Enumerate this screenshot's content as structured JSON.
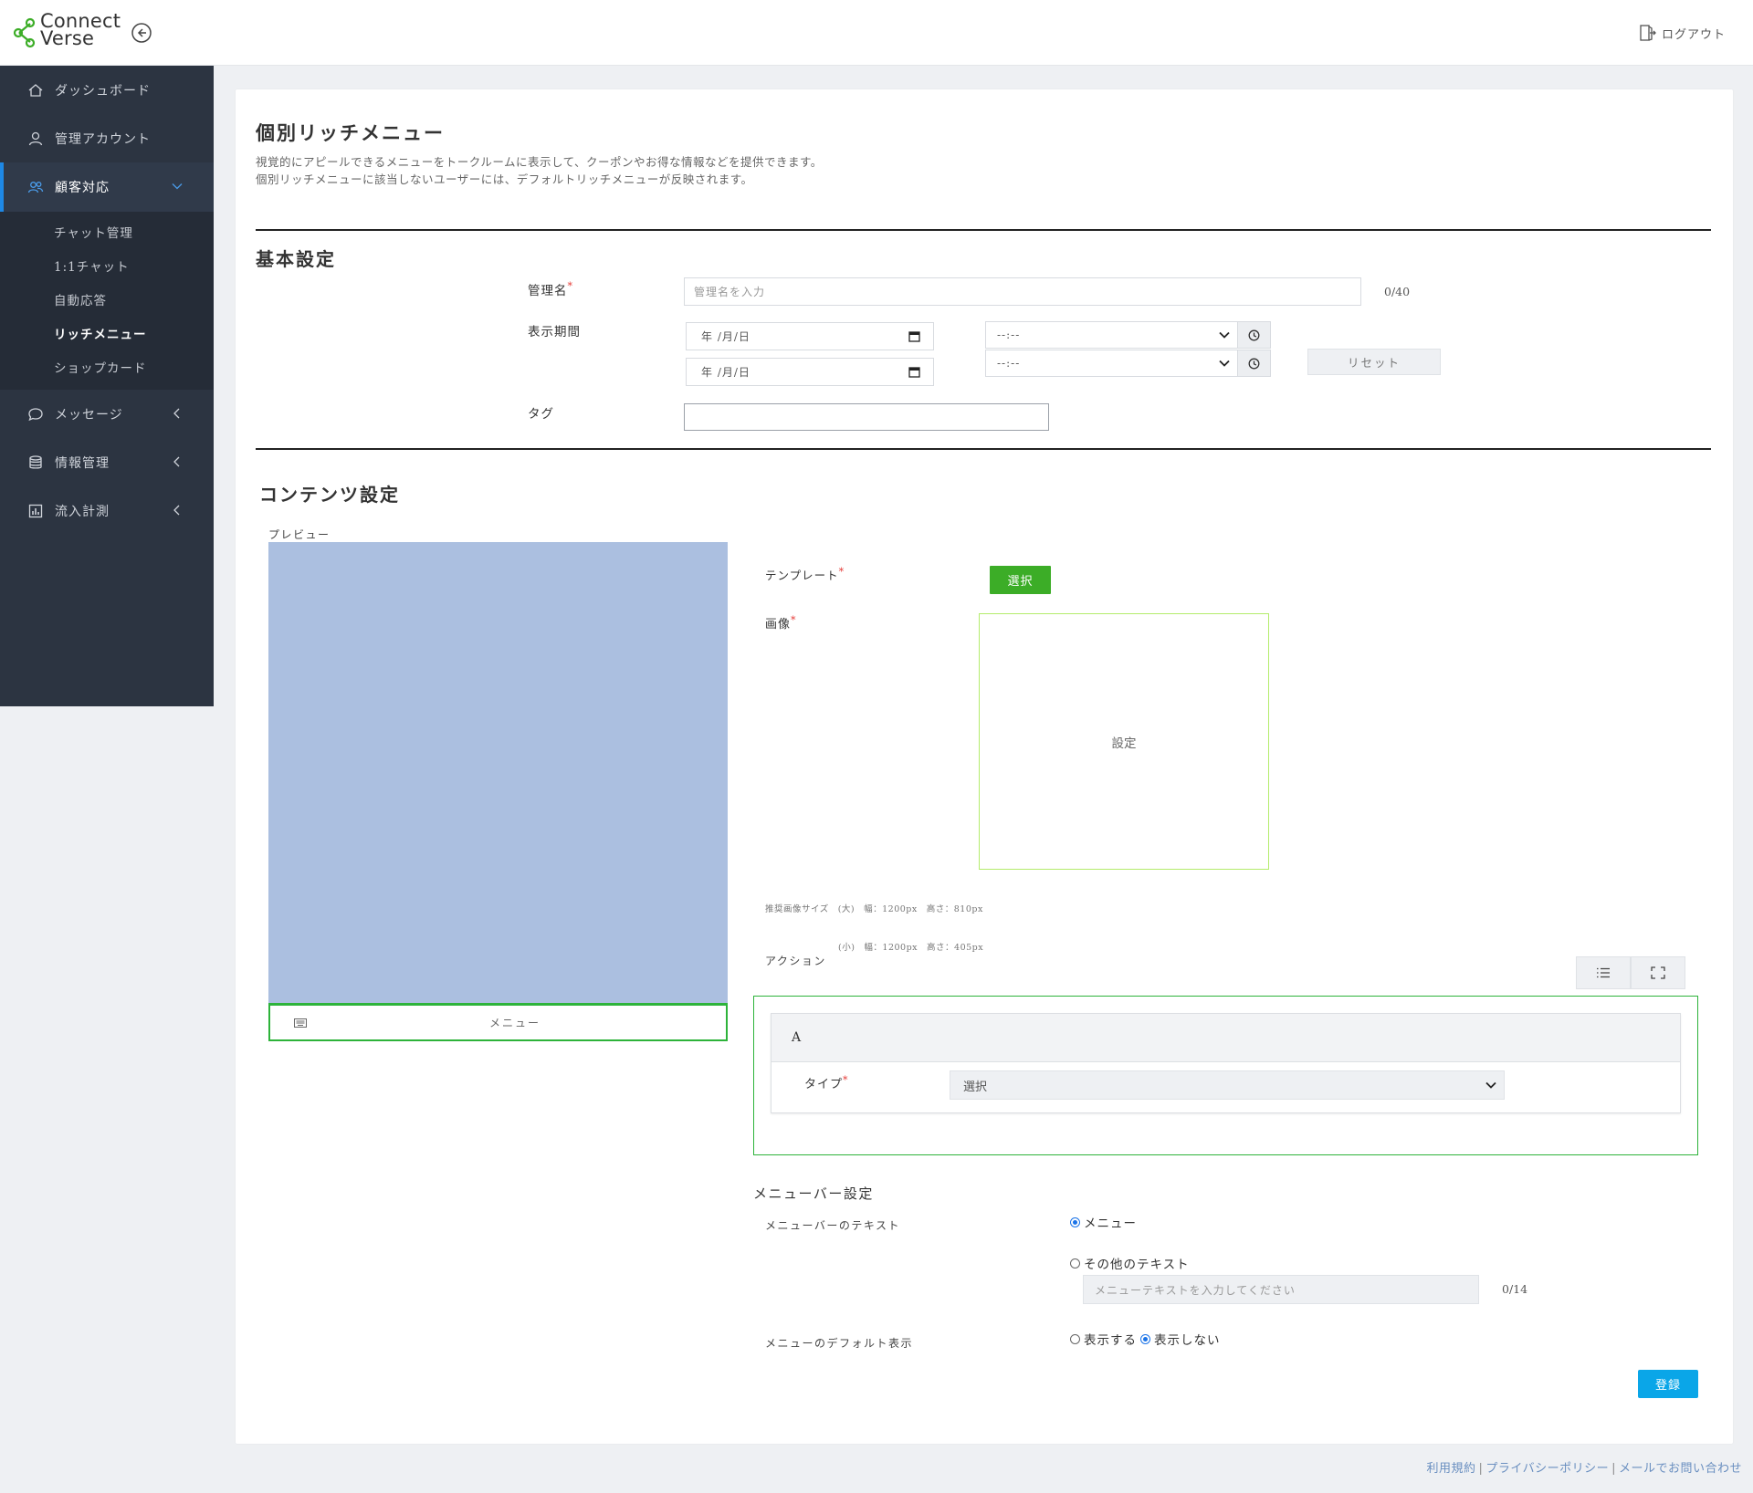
{
  "app": {
    "logo_line1": "Connect",
    "logo_line2": "Verse",
    "logout_label": "ログアウト"
  },
  "sidebar": {
    "items": [
      {
        "label": "ダッシュボード",
        "icon": "home-icon"
      },
      {
        "label": "管理アカウント",
        "icon": "user-icon"
      },
      {
        "label": "顧客対応",
        "icon": "users-icon"
      },
      {
        "label": "メッセージ",
        "icon": "chat-bubble-icon"
      },
      {
        "label": "情報管理",
        "icon": "database-icon"
      },
      {
        "label": "流入計測",
        "icon": "bar-chart-icon"
      }
    ],
    "sub_items": [
      "チャット管理",
      "1:1チャット",
      "自動応答",
      "リッチメニュー",
      "ショップカード"
    ]
  },
  "page": {
    "title": "個別リッチメニュー",
    "desc_line1": "視覚的にアピールできるメニューをトークルームに表示して、クーポンやお得な情報などを提供できます。",
    "desc_line2": "個別リッチメニューに該当しないユーザーには、デフォルトリッチメニューが反映されます。"
  },
  "basic": {
    "section_title": "基本設定",
    "name_label": "管理名",
    "required_mark": "*",
    "name_placeholder": "管理名を入力",
    "name_counter": "0/40",
    "period_label": "表示期間",
    "date_placeholder": "年 /月/日",
    "time_placeholder": "--:--",
    "reset_label": "リセット",
    "tag_label": "タグ"
  },
  "content": {
    "section_title": "コンテンツ設定",
    "preview_label": "プレビュー",
    "preview_menu_text": "メニュー",
    "template_label": "テンプレート",
    "template_button": "選択",
    "image_label": "画像",
    "image_set_label": "設定",
    "size_note_line1": "推奨画像サイズ　(大)　幅：1200px　高さ：810px",
    "size_note_line2": "　　　　　　　　(小)　幅：1200px　高さ：405px",
    "action_label": "アクション",
    "action_card_title": "A",
    "type_label": "タイプ",
    "type_select_value": "選択"
  },
  "menubar": {
    "section_title": "メニューバー設定",
    "text_label": "メニューバーのテキスト",
    "option_menu": "メニュー",
    "option_other": "その他のテキスト",
    "other_placeholder": "メニューテキストを入力してください",
    "other_counter": "0/14",
    "default_label": "メニューのデフォルト表示",
    "option_show": "表示する",
    "option_hide": "表示しない"
  },
  "submit_label": "登録",
  "footer": {
    "terms": "利用規約",
    "privacy": "プライバシーポリシー",
    "contact": "メールでお問い合わせ",
    "separator": "|"
  },
  "colors": {
    "sidebar_bg": "#2c3441",
    "accent_blue": "#1e88e5",
    "brand_green": "#3cad27",
    "preview_blue": "#abbfe0",
    "submit_blue": "#0aa6e8",
    "required_red": "#e53935"
  }
}
